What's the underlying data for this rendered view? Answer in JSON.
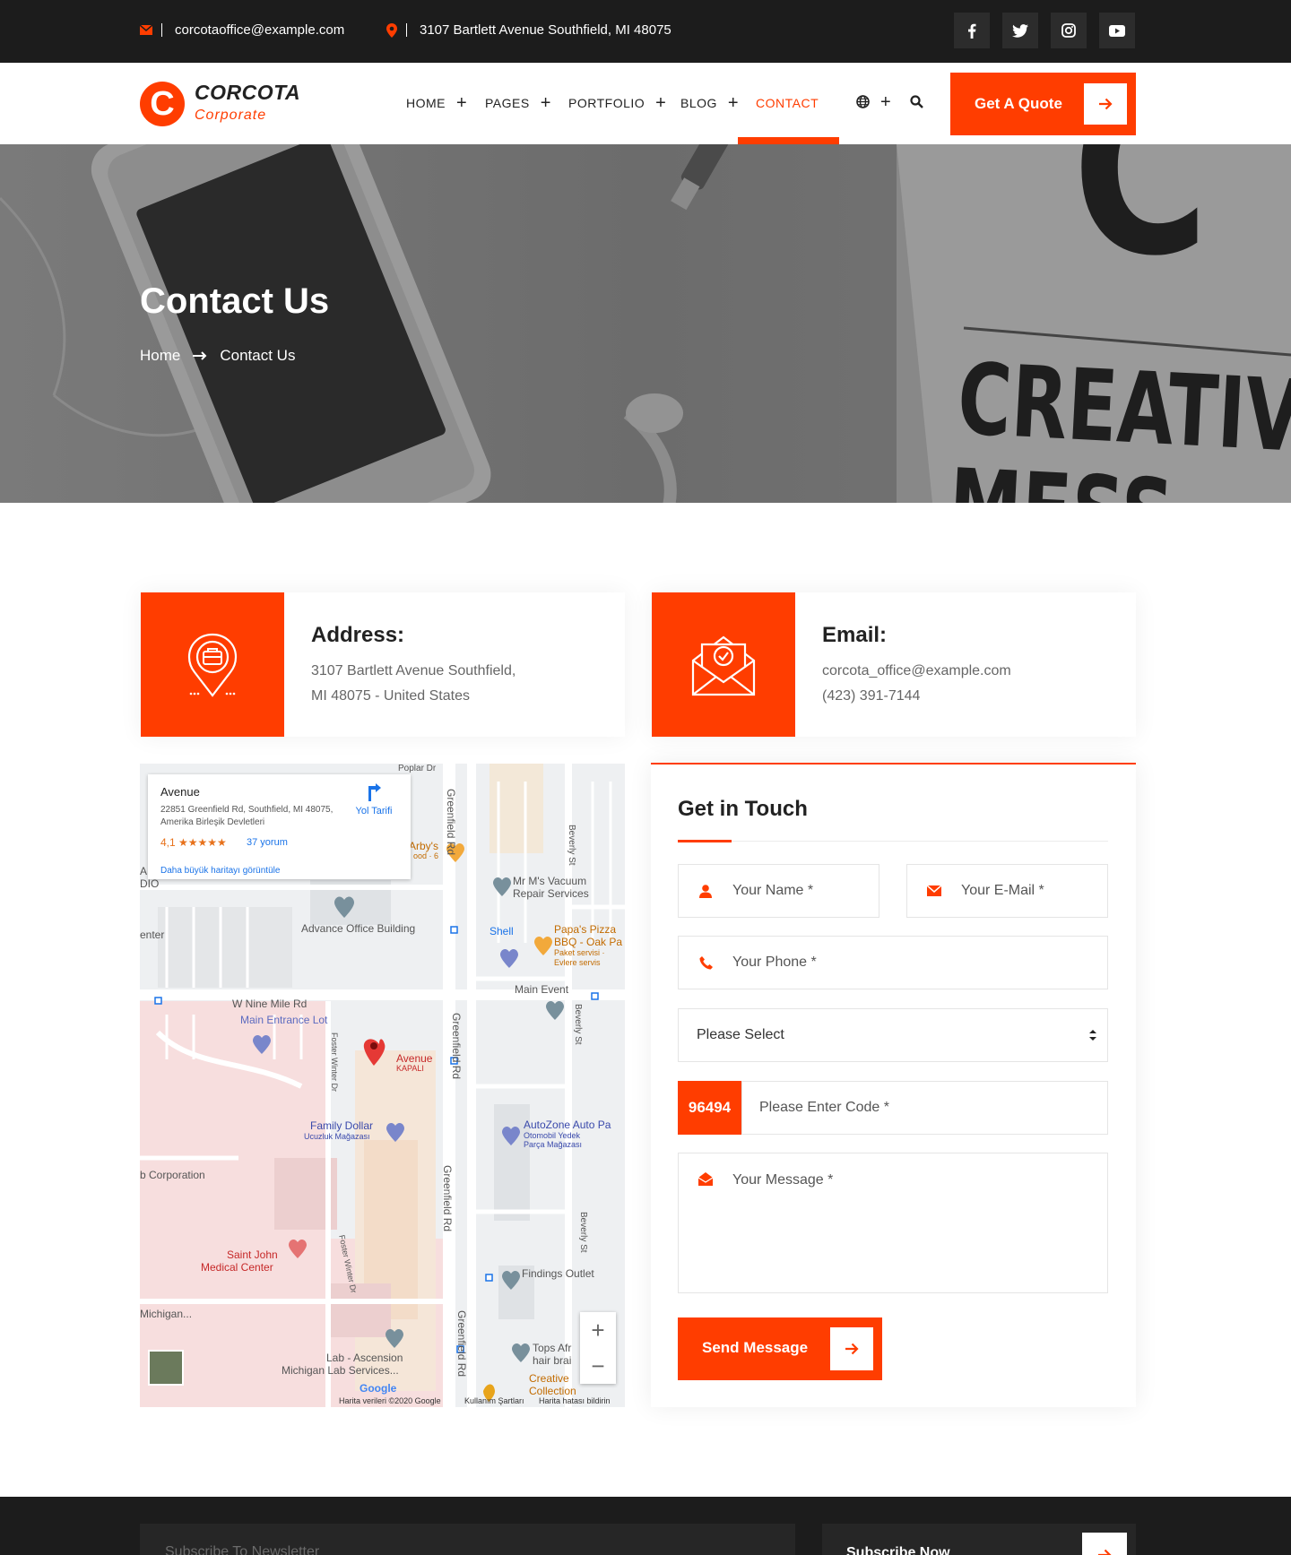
{
  "topbar": {
    "email": "corcotaoffice@example.com",
    "address": "3107 Bartlett Avenue Southfield, MI 48075",
    "social": [
      "facebook-icon",
      "twitter-icon",
      "instagram-icon",
      "youtube-icon"
    ]
  },
  "brand": {
    "letter": "C",
    "name": "CORCOTA",
    "tagline": "Corporate"
  },
  "nav": {
    "items": [
      {
        "label": "HOME"
      },
      {
        "label": "PAGES"
      },
      {
        "label": "PORTFOLIO"
      },
      {
        "label": "BLOG"
      },
      {
        "label": "CONTACT"
      }
    ],
    "cta_label": "Get A Quote"
  },
  "hero": {
    "title": "Contact Us",
    "breadcrumb_home": "Home",
    "breadcrumb_current": "Contact Us",
    "bg_text_1": "C",
    "bg_text_2": "CREATIVE",
    "bg_text_3": "MESS"
  },
  "address_card": {
    "title": "Address:",
    "line1": "3107 Bartlett Avenue Southfield,",
    "line2": "MI 48075 - United States"
  },
  "email_card": {
    "title": "Email:",
    "line1": "corcota_office@example.com",
    "line2": "(423) 391-7144"
  },
  "map": {
    "place_name": "Avenue",
    "place_address": "22851 Greenfield Rd, Southfield, MI 48075, Amerika Birleşik Devletleri",
    "rating": "4,1 ★★★★★",
    "reviews": "37 yorum",
    "directions": "Yol Tarifi",
    "larger_map": "Daha büyük haritayı görüntüle",
    "labels": {
      "advance": "Advance Office Building",
      "mr_m": "Mr M's Vacuum",
      "mr_m_2": "Repair Services",
      "shell": "Shell",
      "papas": "Papa's Pizza",
      "papas_2": "BBQ - Oak Pa",
      "papas_3": "Paket servisi ·",
      "papas_4": "Evlere servis",
      "main_event": "Main Event",
      "nine_mile": "W Nine Mile Rd",
      "main_entrance": "Main Entrance Lot",
      "avenue_pin": "Avenue",
      "avenue_pin_2": "KAPALI",
      "family_dollar": "Family Dollar",
      "family_dollar_2": "Ucuzluk Mağazası",
      "autozone": "AutoZone Auto Pa",
      "autozone_2": "Otomobil Yedek",
      "autozone_3": "Parça Mağazası",
      "corporation": "b Corporation",
      "saint_john": "Saint John",
      "saint_john_2": "Medical Center",
      "findings": "Findings Outlet",
      "michigan": "Michigan...",
      "lab": "Lab - Ascension",
      "lab_2": "Michigan Lab Services...",
      "tops": "Tops Afr",
      "tops_2": "hair brai",
      "creative": "Creative",
      "creative_2": "Collection",
      "arbys": "Arby's",
      "arbys_2": "ood · 6",
      "poplar": "Poplar Dr",
      "greenfield": "Greenfield Rd",
      "beverly": "Beverly St",
      "foster": "Foster Winter Dr",
      "dio": "DIO",
      "enter": "enter",
      "a": "A"
    },
    "attribution_1": "Harita verileri ©2020 Google",
    "attribution_2": "Kullanım Şartları",
    "attribution_3": "Harita hatası bildirin",
    "google": "Google",
    "zoom_in": "+",
    "zoom_out": "−"
  },
  "form": {
    "title": "Get in Touch",
    "name_placeholder": "Your Name *",
    "email_placeholder": "Your E-Mail *",
    "phone_placeholder": "Your Phone *",
    "select_value": "Please Select",
    "captcha": "96494",
    "code_placeholder": "Please Enter Code *",
    "message_placeholder": "Your Message *",
    "submit_label": "Send Message"
  },
  "footer": {
    "newsletter_placeholder": "Subscribe To Newsletter",
    "subscribe_label": "Subscribe Now"
  },
  "colors": {
    "accent": "#ff3d00",
    "dark": "#1c1c1c"
  }
}
